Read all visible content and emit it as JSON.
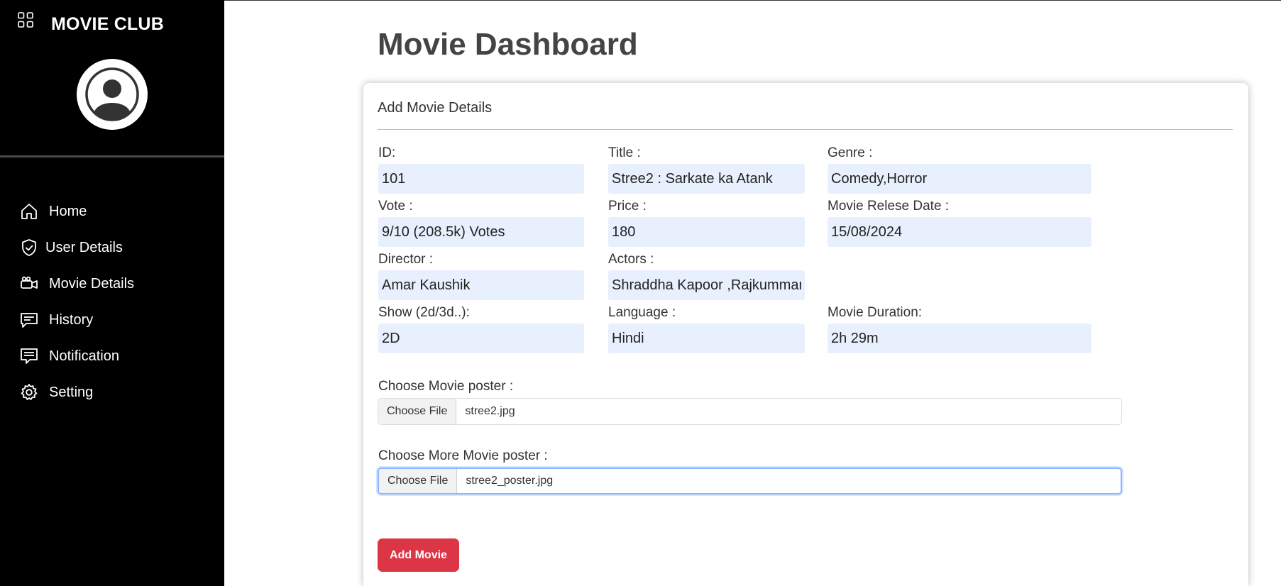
{
  "sidebar": {
    "brand": "MOVIE CLUB",
    "brand_icon": "grid-icon",
    "avatar_icon": "user-circle-icon",
    "items": [
      {
        "label": "Home",
        "icon": "home-icon"
      },
      {
        "label": "User Details",
        "icon": "shield-check-icon"
      },
      {
        "label": "Movie Details",
        "icon": "camera-icon"
      },
      {
        "label": "History",
        "icon": "history-message-icon"
      },
      {
        "label": "Notification",
        "icon": "notification-icon"
      },
      {
        "label": "Setting",
        "icon": "gear-icon"
      }
    ]
  },
  "main": {
    "title": "Movie Dashboard",
    "form": {
      "title": "Add Movie Details",
      "fields": {
        "id": {
          "label": "ID:",
          "value": "101"
        },
        "title": {
          "label": "Title :",
          "value": "Stree2 : Sarkate ka Atank"
        },
        "genre": {
          "label": "Genre :",
          "value": "Comedy,Horror"
        },
        "vote": {
          "label": "Vote :",
          "value": "9/10 (208.5k) Votes"
        },
        "price": {
          "label": "Price :",
          "value": "180"
        },
        "release_date": {
          "label": "Movie Relese Date :",
          "value": "15/08/2024"
        },
        "director": {
          "label": "Director :",
          "value": "Amar Kaushik"
        },
        "actors": {
          "label": "Actors :",
          "value": "Shraddha Kapoor ,Rajkummar"
        },
        "show": {
          "label": "Show (2d/3d..):",
          "value": "2D"
        },
        "language": {
          "label": "Language :",
          "value": "Hindi"
        },
        "duration": {
          "label": "Movie Duration:",
          "value": "2h 29m"
        }
      },
      "poster": {
        "label": "Choose Movie poster :",
        "button": "Choose File",
        "file": "stree2.jpg"
      },
      "more_poster": {
        "label": "Choose More Movie poster :",
        "button": "Choose File",
        "file": "stree2_poster.jpg"
      },
      "submit_label": "Add Movie"
    }
  },
  "colors": {
    "sidebar_bg": "#000000",
    "input_bg": "#e8f0fe",
    "submit_bg": "#dc3545",
    "focus_border": "#8db5ff"
  }
}
